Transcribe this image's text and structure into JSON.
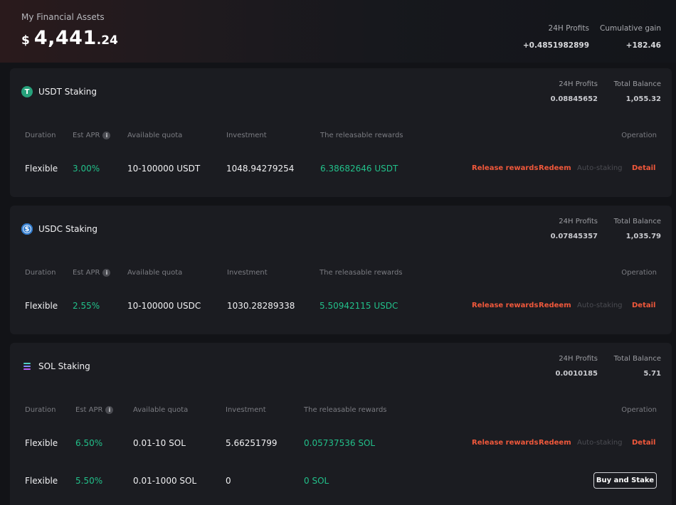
{
  "summary": {
    "title": "My Financial Assets",
    "currency": "$",
    "amount_int": "4,441",
    "amount_dec": ".24",
    "profits_label": "24H Profits",
    "profits_value": "+0.4851982899",
    "gain_label": "Cumulative gain",
    "gain_value": "+182.46"
  },
  "columns": {
    "duration": "Duration",
    "apr": "Est APR",
    "quota": "Available quota",
    "investment": "Investment",
    "rewards": "The releasable rewards",
    "operation": "Operation"
  },
  "actions": {
    "release": "Release rewards",
    "redeem": "Redeem",
    "auto": "Auto-staking",
    "detail": "Detail",
    "buy": "Buy and Stake"
  },
  "cards": [
    {
      "name": "USDT Staking",
      "icon": "usdt-icon",
      "profits_label": "24H Profits",
      "profits": "0.08845652",
      "balance_label": "Total Balance",
      "balance": "1,055.32",
      "rows": [
        {
          "duration": "Flexible",
          "apr": "3.00%",
          "quota": "10-100000 USDT",
          "investment": "1048.94279254",
          "rewards": "6.38682646 USDT"
        }
      ]
    },
    {
      "name": "USDC Staking",
      "icon": "usdc-icon",
      "profits_label": "24H Profits",
      "profits": "0.07845357",
      "balance_label": "Total Balance",
      "balance": "1,035.79",
      "rows": [
        {
          "duration": "Flexible",
          "apr": "2.55%",
          "quota": "10-100000 USDC",
          "investment": "1030.28289338",
          "rewards": "5.50942115 USDC"
        }
      ]
    },
    {
      "name": "SOL Staking",
      "icon": "sol-icon",
      "profits_label": "24H Profits",
      "profits": "0.0010185",
      "balance_label": "Total Balance",
      "balance": "5.71",
      "rows": [
        {
          "duration": "Flexible",
          "apr": "6.50%",
          "quota": "0.01-10 SOL",
          "investment": "5.66251799",
          "rewards": "0.05737536 SOL"
        },
        {
          "duration": "Flexible",
          "apr": "5.50%",
          "quota": "0.01-1000 SOL",
          "investment": "0",
          "rewards": "0 SOL"
        }
      ]
    }
  ],
  "colors": {
    "accent": "#f0583b",
    "positive": "#22c08a",
    "background": "#121317",
    "card": "#1b1c21"
  }
}
